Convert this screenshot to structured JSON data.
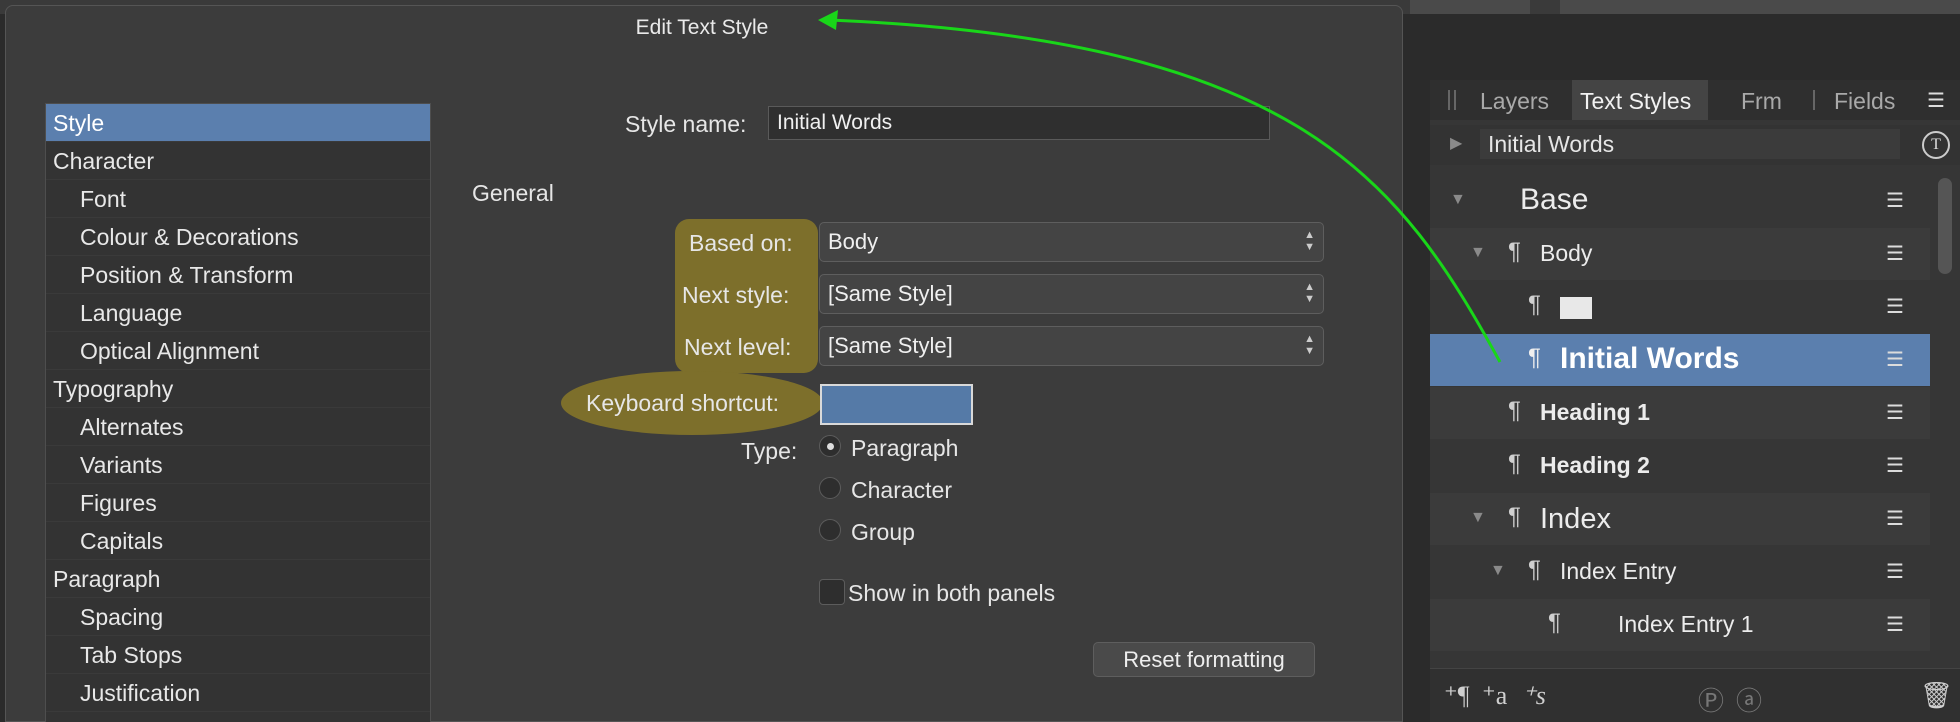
{
  "dialog": {
    "title": "Edit Text Style",
    "categories": [
      {
        "label": "Style",
        "level": "top",
        "selected": true
      },
      {
        "label": "Character",
        "level": "top"
      },
      {
        "label": "Font",
        "level": "sub"
      },
      {
        "label": "Colour & Decorations",
        "level": "sub"
      },
      {
        "label": "Position & Transform",
        "level": "sub"
      },
      {
        "label": "Language",
        "level": "sub"
      },
      {
        "label": "Optical Alignment",
        "level": "sub"
      },
      {
        "label": "Typography",
        "level": "top"
      },
      {
        "label": "Alternates",
        "level": "sub"
      },
      {
        "label": "Variants",
        "level": "sub"
      },
      {
        "label": "Figures",
        "level": "sub"
      },
      {
        "label": "Capitals",
        "level": "sub"
      },
      {
        "label": "Paragraph",
        "level": "top"
      },
      {
        "label": "Spacing",
        "level": "sub"
      },
      {
        "label": "Tab Stops",
        "level": "sub"
      },
      {
        "label": "Justification",
        "level": "sub"
      }
    ],
    "style_name_label": "Style name:",
    "style_name_value": "Initial Words",
    "section_general": "General",
    "based_on_label": "Based on:",
    "based_on_value": "Body",
    "next_style_label": "Next style:",
    "next_style_value": "[Same Style]",
    "next_level_label": "Next level:",
    "next_level_value": "[Same Style]",
    "keyboard_shortcut_label": "Keyboard shortcut:",
    "keyboard_shortcut_value": "",
    "type_label": "Type:",
    "type_options": [
      "Paragraph",
      "Character",
      "Group"
    ],
    "type_selected": "Paragraph",
    "show_both_label": "Show in both panels",
    "reset_button": "Reset formatting",
    "highlight_color": "#7d6f2b",
    "selection_color": "#5b7fae"
  },
  "panel": {
    "tabs": [
      "Layers",
      "Text Styles",
      "Frm",
      "Fields"
    ],
    "active_tab": "Text Styles",
    "search_value": "Initial Words",
    "styles": [
      {
        "name": "Base"
      },
      {
        "name": "Body"
      },
      {
        "name": ""
      },
      {
        "name": "Initial Words",
        "selected": true
      },
      {
        "name": "Heading 1"
      },
      {
        "name": "Heading 2"
      },
      {
        "name": "Index"
      },
      {
        "name": "Index Entry"
      },
      {
        "name": "Index Entry 1"
      }
    ]
  },
  "annotation": {
    "arrow_color": "#19d619"
  }
}
